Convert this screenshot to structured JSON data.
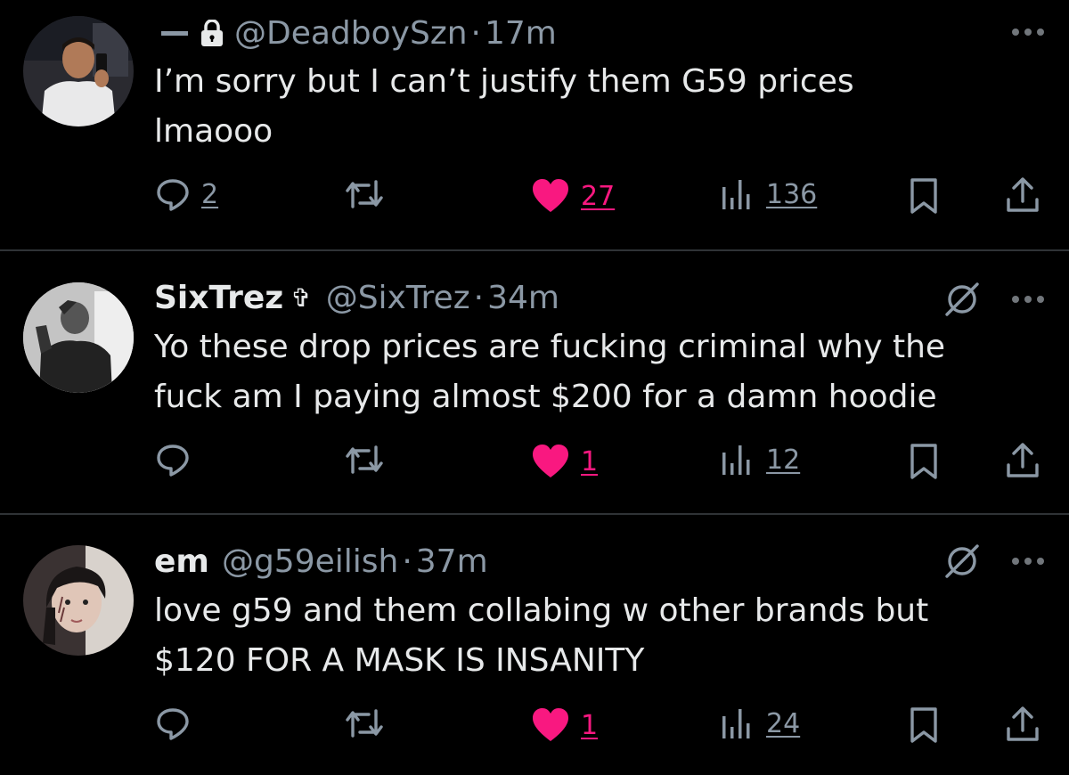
{
  "tweets": [
    {
      "name": "",
      "handle": "@DeadboySzn",
      "time": "17m",
      "text_lines": [
        "I’m sorry but I can’t justify them G59 prices",
        "lmaooo"
      ],
      "replies": "2",
      "likes": "27",
      "views": "136",
      "has_lock": true,
      "has_grok": false
    },
    {
      "name": "SixTrez",
      "name_glyph": "✞",
      "handle": "@SixTrez",
      "time": "34m",
      "text_lines": [
        "Yo these drop prices are fucking criminal why the",
        "fuck am I paying almost $200 for a damn hoodie"
      ],
      "replies": "",
      "likes": "1",
      "views": "12",
      "has_lock": false,
      "has_grok": true
    },
    {
      "name": "em",
      "handle": "@g59eilish",
      "time": "37m",
      "text_lines": [
        "love g59 and them collabing w other brands but",
        "$120 FOR A MASK IS INSANITY"
      ],
      "replies": "",
      "likes": "1",
      "views": "24",
      "has_lock": false,
      "has_grok": true
    }
  ],
  "separator": "·",
  "colors": {
    "like": "#f91880",
    "muted": "#8b98a5",
    "text": "#e7e9ea",
    "background": "#000000"
  },
  "icons": [
    "reply-icon",
    "retweet-icon",
    "heart-icon",
    "views-icon",
    "bookmark-icon",
    "share-icon",
    "lock-icon",
    "grok-icon",
    "more-icon"
  ]
}
